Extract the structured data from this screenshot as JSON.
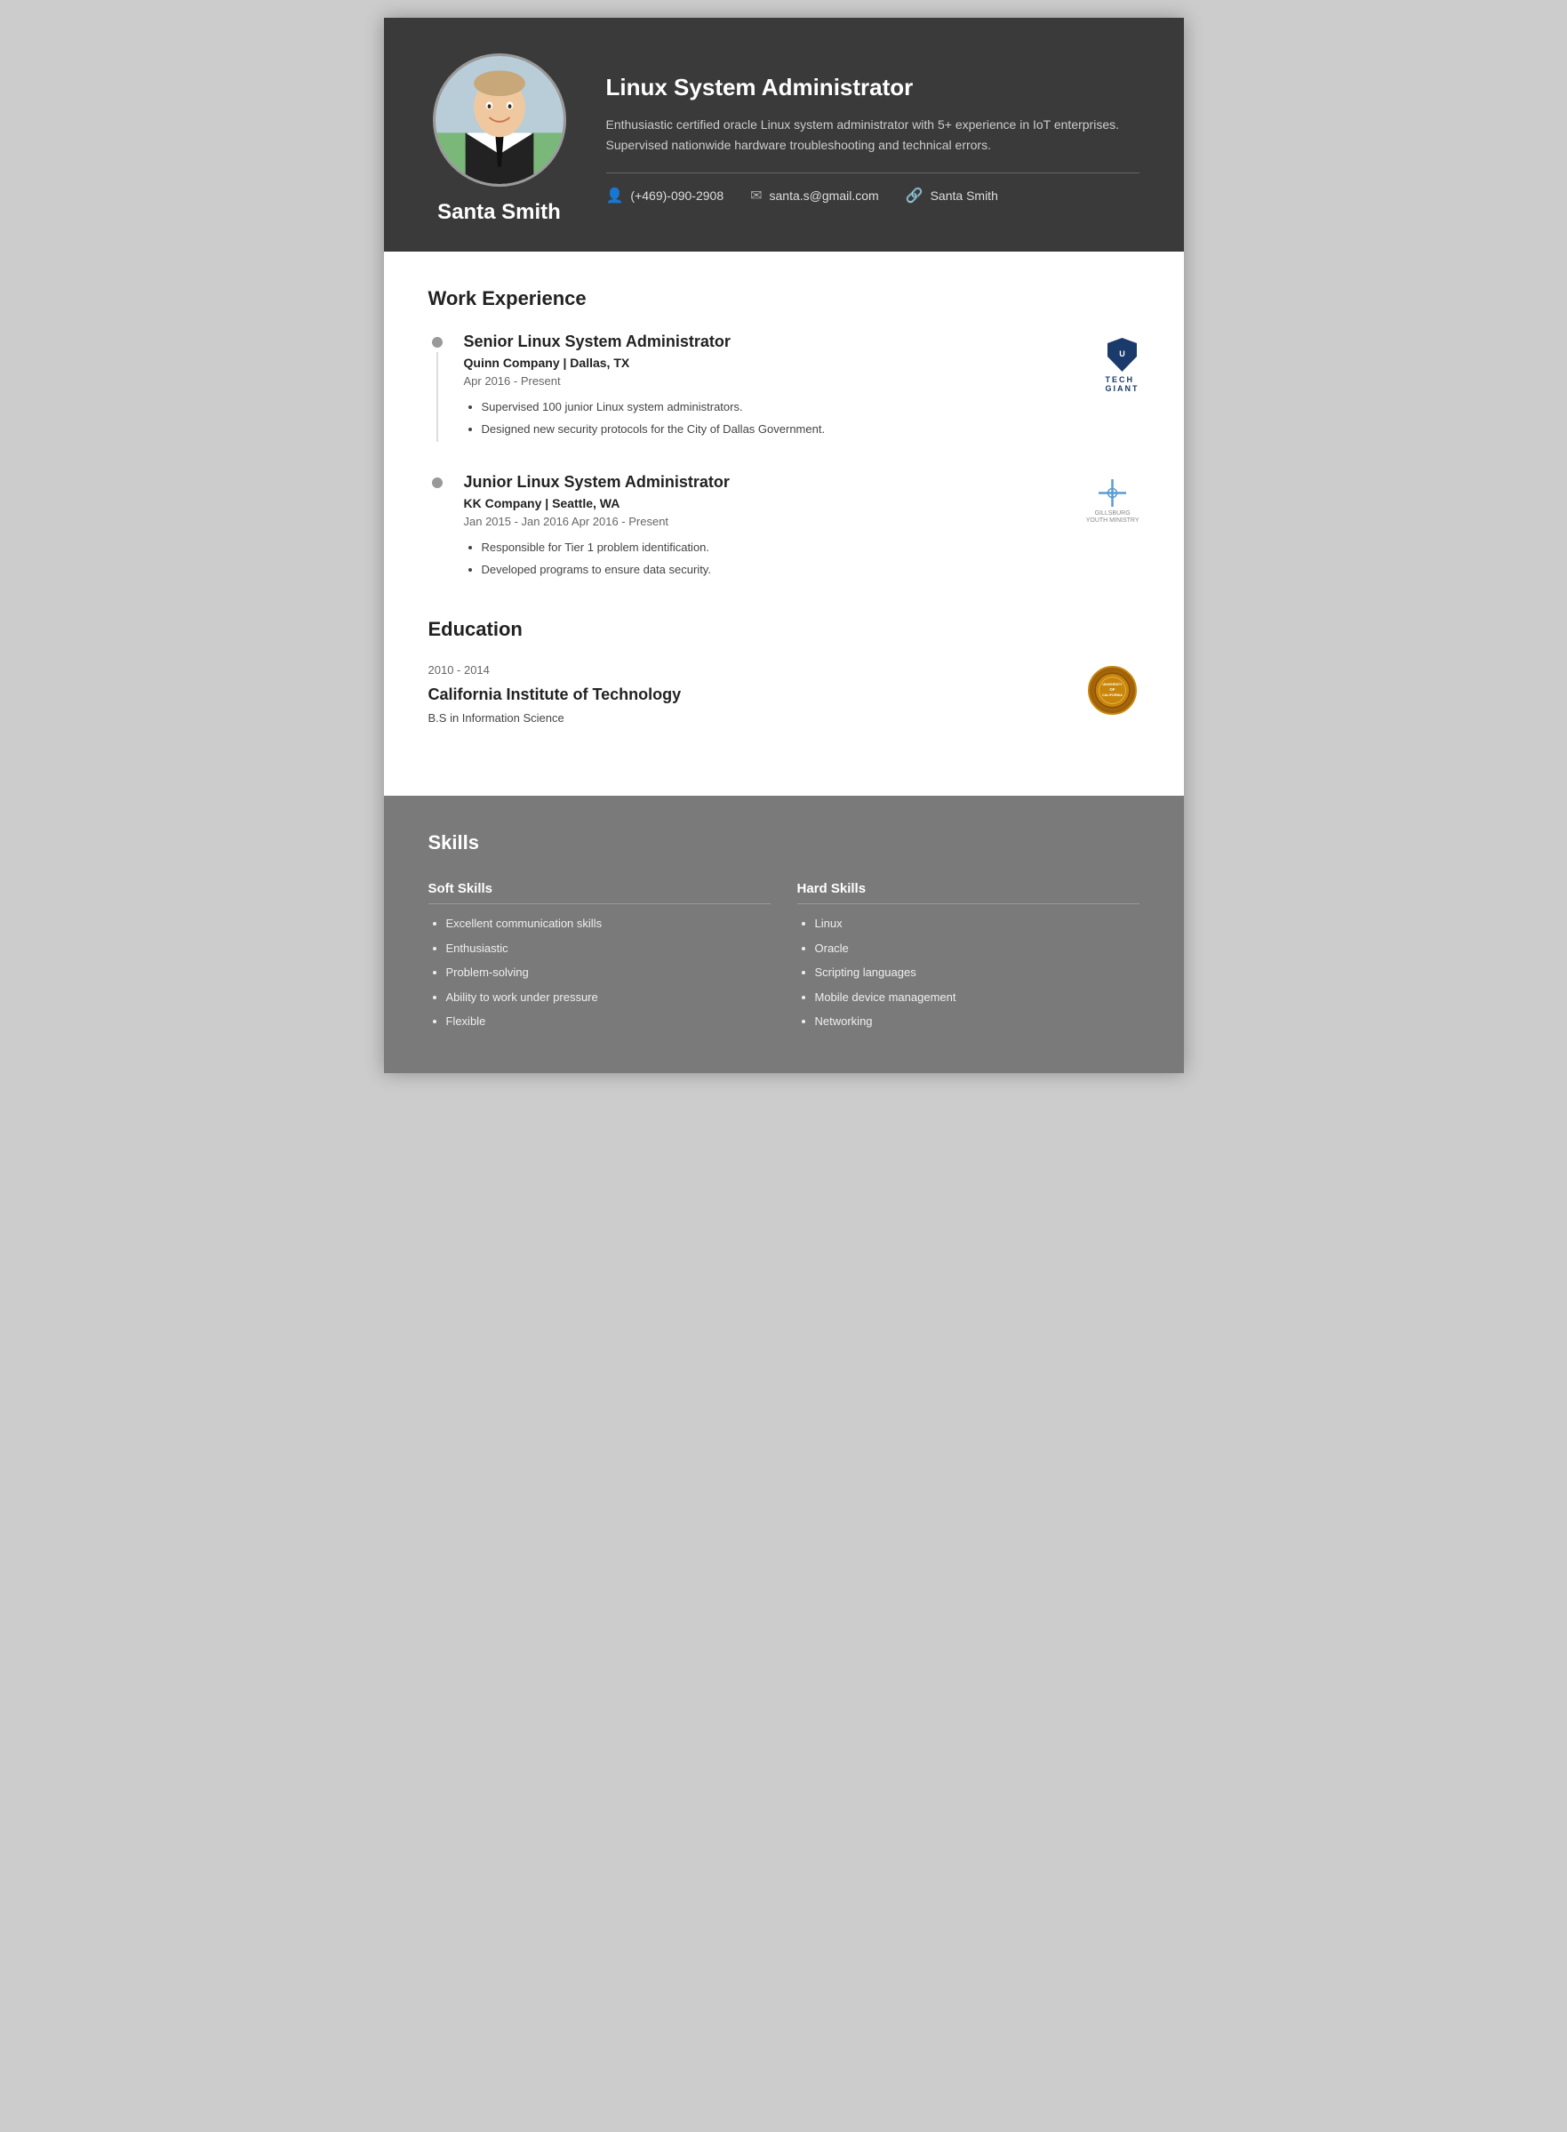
{
  "header": {
    "name": "Santa Smith",
    "job_title": "Linux System Administrator",
    "summary": "Enthusiastic certified oracle Linux system administrator with 5+ experience in IoT enterprises. Supervised nationwide hardware troubleshooting and technical errors.",
    "contact": {
      "phone": "(+469)-090-2908",
      "email": "santa.s@gmail.com",
      "linkedin": "Santa Smith"
    }
  },
  "work_experience": {
    "section_title": "Work Experience",
    "jobs": [
      {
        "role": "Senior Linux System Administrator",
        "company": "Quinn Company | Dallas, TX",
        "dates": "Apr 2016 - Present",
        "bullets": [
          "Supervised 100 junior Linux system administrators.",
          "Designed new security protocols for the City of Dallas Government."
        ],
        "logo": "tech_giant"
      },
      {
        "role": "Junior Linux System Administrator",
        "company": "KK Company | Seattle, WA",
        "dates": "Jan 2015 - Jan 2016 Apr 2016 - Present",
        "bullets": [
          "Responsible for Tier 1 problem identification.",
          "Developed programs to ensure data security."
        ],
        "logo": "ministry"
      }
    ]
  },
  "education": {
    "section_title": "Education",
    "items": [
      {
        "dates": "2010 - 2014",
        "school": "California Institute of Technology",
        "degree": "B.S in Information Science"
      }
    ]
  },
  "skills": {
    "section_title": "Skills",
    "soft": {
      "title": "Soft Skills",
      "items": [
        "Excellent communication skills",
        "Enthusiastic",
        "Problem-solving",
        "Ability to work under pressure",
        "Flexible"
      ]
    },
    "hard": {
      "title": "Hard Skills",
      "items": [
        "Linux",
        "Oracle",
        "Scripting languages",
        "Mobile device management",
        "Networking"
      ]
    }
  }
}
